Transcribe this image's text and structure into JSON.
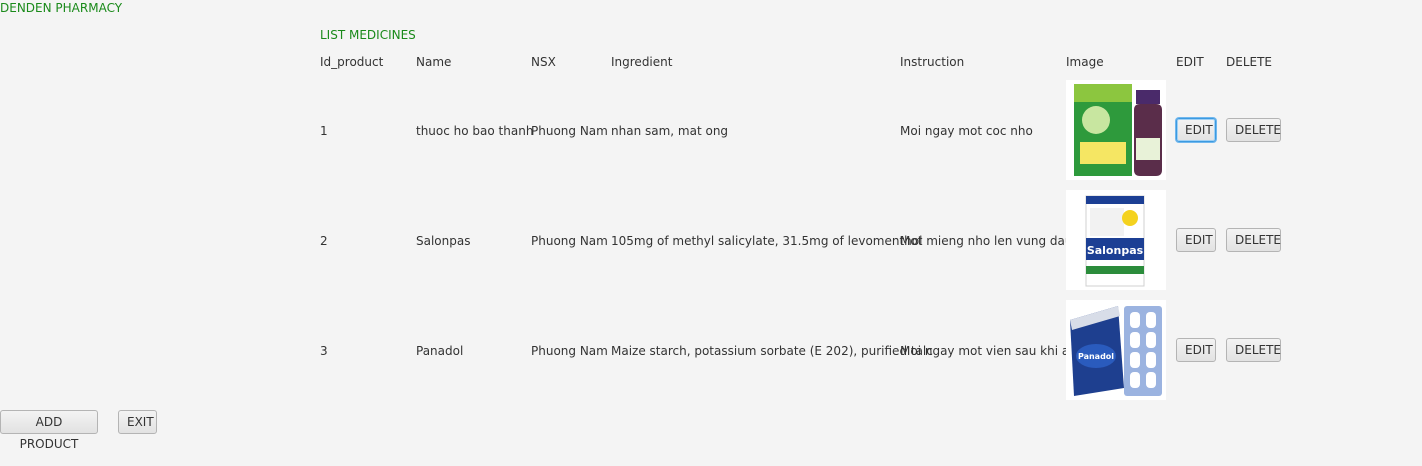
{
  "app": {
    "title": "DENDEN PHARMACY"
  },
  "list_title": "LIST MEDICINES",
  "columns": [
    "Id_product",
    "Name",
    "NSX",
    "Ingredient",
    "Instruction",
    "Image",
    "EDIT",
    "DELETE"
  ],
  "rows": [
    {
      "id": "1",
      "name": "thuoc ho bao thanh",
      "nsx": "Phuong Nam",
      "ingredient": "nhan sam, mat ong",
      "instruction": "Moi ngay mot coc nho",
      "image": "cough-syrup-box-image",
      "edit": "EDIT",
      "delete": "DELETE"
    },
    {
      "id": "2",
      "name": "Salonpas",
      "nsx": "Phuong Nam",
      "ingredient": "105mg of methyl salicylate, 31.5mg of levomenthol",
      "instruction": "Mot mieng nho len vung dau",
      "image": "salonpas-box-image",
      "image_text": "Salonpas",
      "edit": "EDIT",
      "delete": "DELETE"
    },
    {
      "id": "3",
      "name": "Panadol",
      "nsx": "Phuong Nam",
      "ingredient": "Maize starch, potassium sorbate (E 202), purified talc",
      "instruction": "Moi ngay mot vien sau khi an",
      "image": "panadol-box-image",
      "image_text": "Panadol",
      "edit": "EDIT",
      "delete": "DELETE"
    }
  ],
  "footer": {
    "add_label": "ADD PRODUCT",
    "exit_label": "EXIT"
  },
  "colors": {
    "accent": "#1a8a1a",
    "background": "#f4f4f4",
    "focus": "#3c9ae0"
  }
}
